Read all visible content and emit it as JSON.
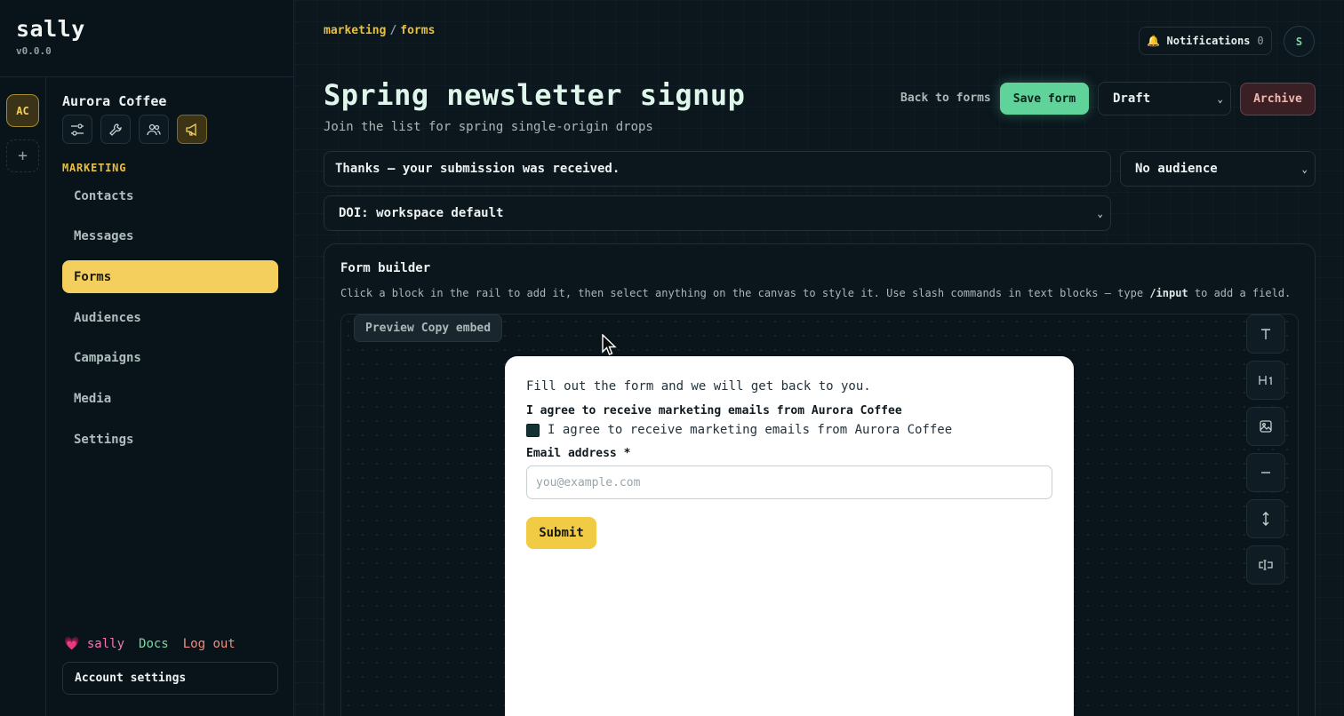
{
  "app": {
    "name": "sally",
    "version": "v0.0.0"
  },
  "workspace": {
    "initials": "AC",
    "name": "Aurora Coffee",
    "add_label": "+"
  },
  "sidebar": {
    "section_label": "MARKETING",
    "items": [
      {
        "label": "Contacts",
        "active": false
      },
      {
        "label": "Messages",
        "active": false
      },
      {
        "label": "Forms",
        "active": true
      },
      {
        "label": "Audiences",
        "active": false
      },
      {
        "label": "Campaigns",
        "active": false
      },
      {
        "label": "Media",
        "active": false
      },
      {
        "label": "Settings",
        "active": false
      }
    ],
    "footer": {
      "sally_label": "💗 sally",
      "docs_label": "Docs",
      "logout_label": "Log out"
    },
    "account_settings_label": "Account settings"
  },
  "header": {
    "breadcrumb": {
      "parent": "marketing",
      "separator": "/",
      "current": "forms"
    },
    "notifications_label": "🔔 Notifications",
    "notifications_count": "0",
    "avatar_initial": "S"
  },
  "page": {
    "title": "Spring newsletter signup",
    "subtitle": "Join the list for spring single-origin drops",
    "back_label": "Back to forms",
    "save_label": "Save form",
    "status_value": "Draft",
    "archive_label": "Archive"
  },
  "settings": {
    "thanks_message": "Thanks — your submission was received.",
    "audience_value": "No audience",
    "doi_value": "DOI: workspace default"
  },
  "builder": {
    "title": "Form builder",
    "help_before": "Click a block in the rail to add it, then select anything on the canvas to style it. Use slash commands in text blocks — type ",
    "help_command": "/input",
    "help_after": " to add a field.",
    "preview_label": "Preview",
    "copy_embed_label": "Copy embed",
    "rail_icons": [
      "text-icon",
      "heading-icon",
      "image-icon",
      "divider-icon",
      "spacer-icon",
      "input-icon"
    ],
    "form": {
      "intro": "Fill out the form and we will get back to you.",
      "consent_label": "I agree to receive marketing emails from Aurora Coffee",
      "consent_checkbox_text": "I agree to receive marketing emails from Aurora Coffee",
      "email_label": "Email address *",
      "email_placeholder": "you@example.com",
      "submit_label": "Submit"
    }
  },
  "colors": {
    "accent_yellow": "#f4cf5e",
    "save_green": "#5fd39a",
    "archive_red": "#7b3a45",
    "background": "#0a141b"
  }
}
